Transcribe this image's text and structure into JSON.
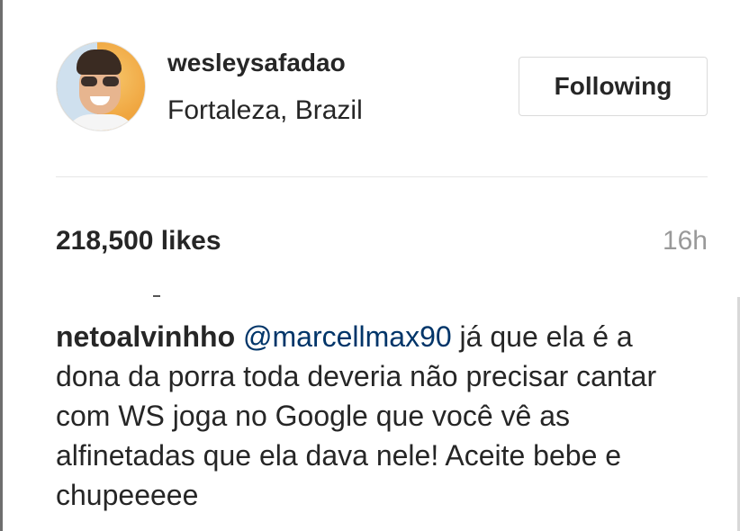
{
  "post": {
    "username": "wesleysafadao",
    "location": "Fortaleza, Brazil",
    "follow_label": "Following",
    "likes": "218,500 likes",
    "time": "16h",
    "avatar_icon": "profile-photo"
  },
  "comment": {
    "author": "netoalvinhho",
    "mention": "@marcellmax90",
    "text": " já que ela é a dona da porra toda deveria não precisar cantar com WS joga no Google que você vê as alfinetadas que ela dava nele! Aceite bebe e chupeeeee"
  },
  "colors": {
    "text": "#262626",
    "mention": "#003569",
    "muted": "#999999",
    "divider": "#e6e6e6"
  }
}
